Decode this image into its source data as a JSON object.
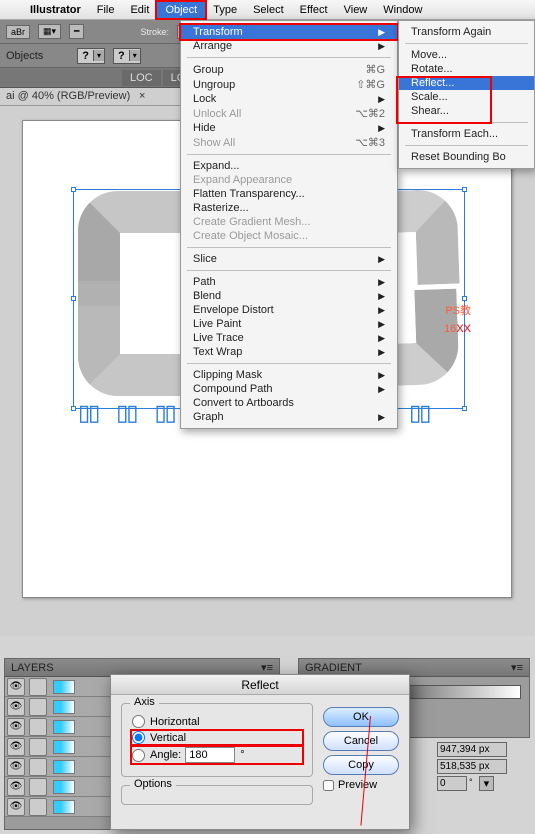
{
  "menubar": {
    "app": "Illustrator",
    "items": [
      "File",
      "Edit",
      "Object",
      "Type",
      "Select",
      "Effect",
      "View",
      "Window"
    ],
    "selected": "Object",
    "apple": ""
  },
  "toolbar": {
    "abr": "aBr",
    "stroke_label": "Stroke:"
  },
  "objectsbar": {
    "label": "Objects"
  },
  "tabs": {
    "tab1": "LOC",
    "tab2": "LOC",
    "status": "ai @ 40% (RGB/Preview)",
    "close": "×"
  },
  "object_menu": {
    "transform": "Transform",
    "arrange": "Arrange",
    "group": "Group",
    "group_sc": "⌘G",
    "ungroup": "Ungroup",
    "ungroup_sc": "⇧⌘G",
    "lock": "Lock",
    "unlockall": "Unlock All",
    "unlockall_sc": "⌥⌘2",
    "hide": "Hide",
    "showall": "Show All",
    "showall_sc": "⌥⌘3",
    "expand": "Expand...",
    "expandapp": "Expand Appearance",
    "flatten": "Flatten Transparency...",
    "rasterize": "Rasterize...",
    "gradmesh": "Create Gradient Mesh...",
    "mosaic": "Create Object Mosaic...",
    "slice": "Slice",
    "path": "Path",
    "blend": "Blend",
    "envelope": "Envelope Distort",
    "livepaint": "Live Paint",
    "livetrace": "Live Trace",
    "textwrap": "Text Wrap",
    "clipmask": "Clipping Mask",
    "comppath": "Compound Path",
    "toartboards": "Convert to Artboards",
    "graph": "Graph"
  },
  "transform_menu": {
    "again": "Transform Again",
    "move": "Move...",
    "rotate": "Rotate...",
    "reflect": "Reflect...",
    "scale": "Scale...",
    "shear": "Shear...",
    "each": "Transform Each...",
    "reset": "Reset Bounding Bo"
  },
  "watermark": {
    "line1": "PS教",
    "line2": "16",
    "line3": "XX"
  },
  "layers_panel": {
    "title": "LAYERS"
  },
  "gradient_panel": {
    "title": "GRADIENT"
  },
  "reflect_dialog": {
    "title": "Reflect",
    "axis_label": "Axis",
    "horizontal": "Horizontal",
    "vertical": "Vertical",
    "angle_label": "Angle:",
    "angle_value": "180",
    "deg": "°",
    "options_label": "Options",
    "ok": "OK",
    "cancel": "Cancel",
    "copy": "Copy",
    "preview": "Preview"
  },
  "right_fields": {
    "w": "947,394 px",
    "h": "518,535 px",
    "ang": "0",
    "unit": "°"
  }
}
